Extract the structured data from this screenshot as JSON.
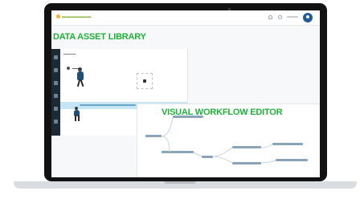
{
  "callouts": {
    "data_asset_library": "DATA ASSET LIBRARY",
    "visual_workflow_editor": "VISUAL WORKFLOW EDITOR"
  },
  "colors": {
    "callout": "#1fb23a",
    "selected_row": "#c6e6f5",
    "avatar": "#1f5c99",
    "rail": "#1c2a36"
  },
  "icons": [
    "bell-icon",
    "help-icon",
    "user-avatar-icon",
    "folder-icon",
    "upload-icon"
  ]
}
